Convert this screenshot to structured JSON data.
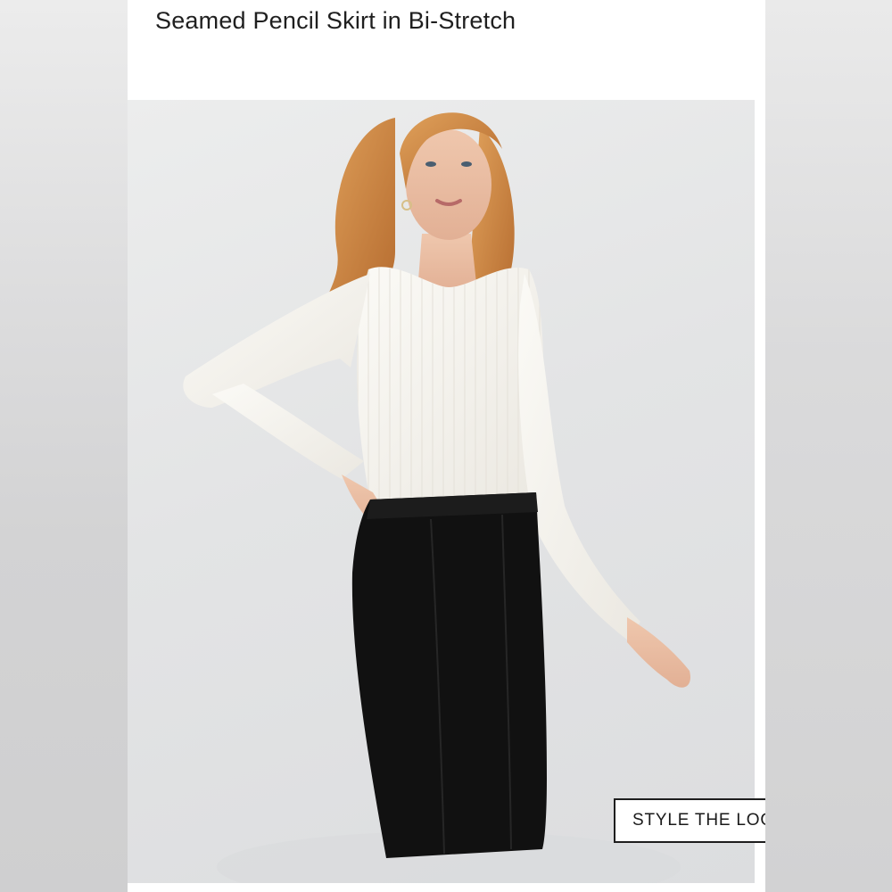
{
  "product": {
    "title": "Seamed Pencil Skirt in Bi-Stretch"
  },
  "photo": {
    "icon": "model-photo-icon"
  },
  "style_button": {
    "label": "STYLE THE LOOK"
  },
  "colors": {
    "background": "#d9d9da",
    "card": "#ffffff",
    "photo_backdrop": "#e3e4e5",
    "sweater": "#f7f5f0",
    "skirt": "#111111",
    "hair": "#c9813f",
    "button_border": "#1e1e1e"
  }
}
